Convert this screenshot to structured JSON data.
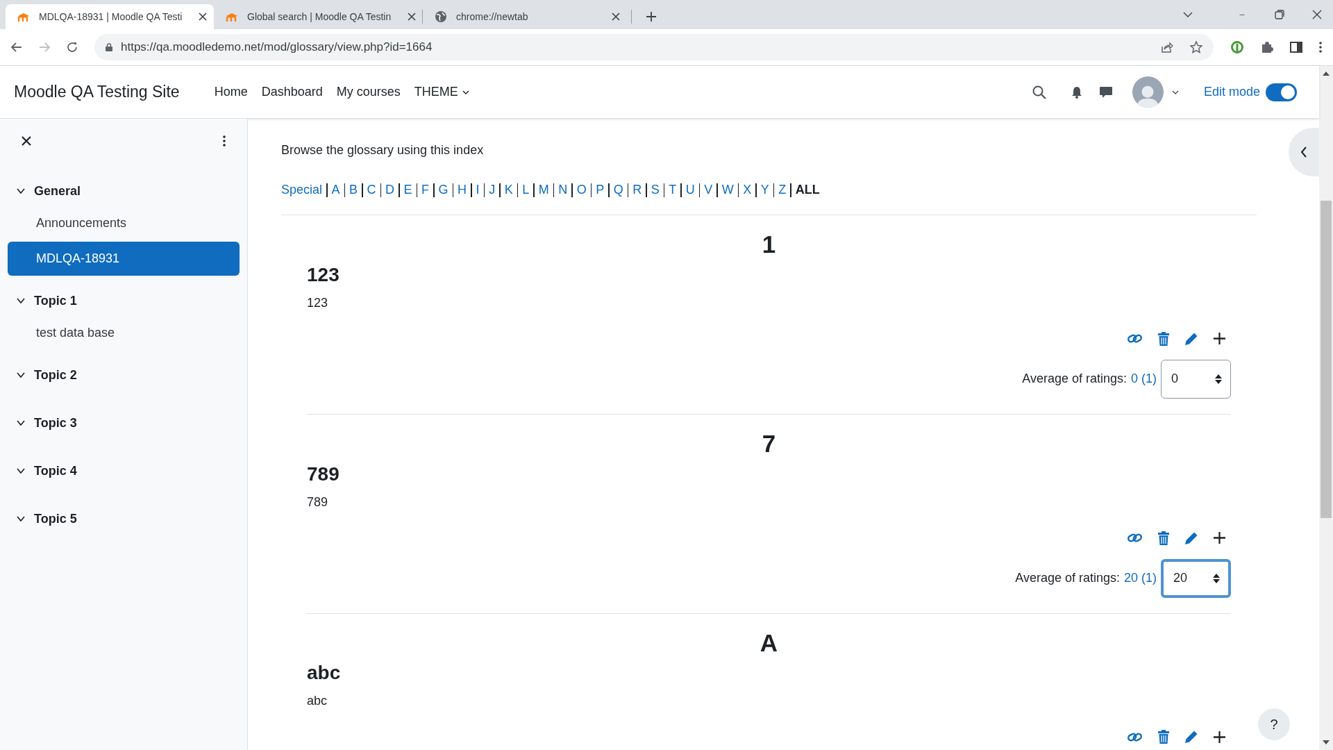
{
  "browser": {
    "tabs": [
      {
        "title": "MDLQA-18931 | Moodle QA Testi",
        "kind": "moodle",
        "selected": true
      },
      {
        "title": "Global search | Moodle QA Testin",
        "kind": "moodle",
        "selected": false
      },
      {
        "title": "chrome://newtab",
        "kind": "web",
        "selected": false
      }
    ],
    "url": "https://qa.moodledemo.net/mod/glossary/view.php?id=1664"
  },
  "navbar": {
    "site_name": "Moodle QA Testing Site",
    "links": [
      {
        "label": "Home",
        "kind": "link"
      },
      {
        "label": "Dashboard",
        "kind": "link"
      },
      {
        "label": "My courses",
        "kind": "link"
      },
      {
        "label": "THEME",
        "kind": "menu"
      }
    ],
    "edit_mode": {
      "label": "Edit mode",
      "on": true
    }
  },
  "sidebar": {
    "items": [
      {
        "label": "General",
        "expanded": true,
        "children": [
          {
            "label": "Announcements",
            "selected": false
          },
          {
            "label": "MDLQA-18931",
            "selected": true
          }
        ]
      },
      {
        "label": "Topic 1",
        "expanded": true,
        "children": [
          {
            "label": "test data base",
            "selected": false
          }
        ]
      },
      {
        "label": "Topic 2",
        "expanded": true
      },
      {
        "label": "Topic 3",
        "expanded": true
      },
      {
        "label": "Topic 4",
        "expanded": true
      },
      {
        "label": "Topic 5",
        "expanded": true
      }
    ]
  },
  "content": {
    "intro": "Browse the glossary using this index",
    "index": [
      {
        "label": "Special",
        "selected": false
      },
      {
        "label": "A",
        "selected": false
      },
      {
        "label": "B",
        "selected": false
      },
      {
        "label": "C",
        "selected": false
      },
      {
        "label": "D",
        "selected": false
      },
      {
        "label": "E",
        "selected": false
      },
      {
        "label": "F",
        "selected": false
      },
      {
        "label": "G",
        "selected": false
      },
      {
        "label": "H",
        "selected": false
      },
      {
        "label": "I",
        "selected": false
      },
      {
        "label": "J",
        "selected": false
      },
      {
        "label": "K",
        "selected": false
      },
      {
        "label": "L",
        "selected": false
      },
      {
        "label": "M",
        "selected": false
      },
      {
        "label": "N",
        "selected": false
      },
      {
        "label": "O",
        "selected": false
      },
      {
        "label": "P",
        "selected": false
      },
      {
        "label": "Q",
        "selected": false
      },
      {
        "label": "R",
        "selected": false
      },
      {
        "label": "S",
        "selected": false
      },
      {
        "label": "T",
        "selected": false
      },
      {
        "label": "U",
        "selected": false
      },
      {
        "label": "V",
        "selected": false
      },
      {
        "label": "W",
        "selected": false
      },
      {
        "label": "X",
        "selected": false
      },
      {
        "label": "Y",
        "selected": false
      },
      {
        "label": "Z",
        "selected": false
      },
      {
        "label": "ALL",
        "selected": true
      }
    ],
    "sections": [
      {
        "heading": "1",
        "term": "123",
        "definition": "123",
        "rating": {
          "label": "Average of ratings:",
          "value": "0 (1)",
          "select": "0",
          "focused": false
        }
      },
      {
        "heading": "7",
        "term": "789",
        "definition": "789",
        "rating": {
          "label": "Average of ratings:",
          "value": "20 (1)",
          "select": "20",
          "focused": true
        }
      },
      {
        "heading": "A",
        "term": "abc",
        "definition": "abc"
      }
    ]
  },
  "help_button": "?"
}
